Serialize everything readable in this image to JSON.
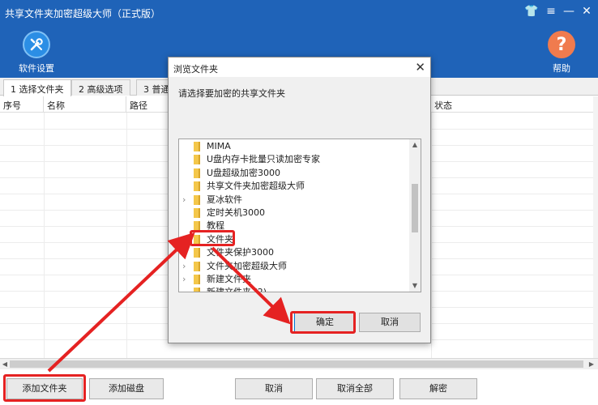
{
  "window": {
    "title": "共享文件夹加密超级大师（正式版）",
    "controls": {
      "skin": "👕",
      "menu": "≡",
      "minimize": "—",
      "close": "✕"
    }
  },
  "toolbar": {
    "settings_label": "软件设置",
    "help_label": "帮助",
    "help_glyph": "?"
  },
  "tabs": [
    {
      "label": "1 选择文件夹",
      "active": true
    },
    {
      "label": "2 高级选项",
      "active": false
    },
    {
      "label": "3 普通",
      "active": false
    }
  ],
  "table": {
    "columns": [
      "序号",
      "名称",
      "路径",
      "状态"
    ]
  },
  "buttons": {
    "add_folder": "添加文件夹",
    "add_disk": "添加磁盘",
    "cancel": "取消",
    "cancel_all": "取消全部",
    "decrypt": "解密"
  },
  "dialog": {
    "title": "浏览文件夹",
    "close_glyph": "✕",
    "prompt": "请选择要加密的共享文件夹",
    "folders": [
      {
        "label": "MIMA",
        "expandable": false
      },
      {
        "label": "U盘内存卡批量只读加密专家",
        "expandable": false
      },
      {
        "label": "U盘超级加密3000",
        "expandable": false
      },
      {
        "label": "共享文件夹加密超级大师",
        "expandable": false
      },
      {
        "label": "夏冰软件",
        "expandable": true
      },
      {
        "label": "定时关机3000",
        "expandable": false
      },
      {
        "label": "教程",
        "expandable": false
      },
      {
        "label": "文件夹",
        "expandable": true
      },
      {
        "label": "文件夹保护3000",
        "expandable": false
      },
      {
        "label": "文件夹加密超级大师",
        "expandable": true
      },
      {
        "label": "新建文件夹",
        "expandable": true
      },
      {
        "label": "新建文件夹 (2)",
        "expandable": false
      }
    ],
    "expander_glyph": "›",
    "scroll_up": "▲",
    "scroll_down": "▼",
    "ok_label": "确定",
    "cancel_label": "取消"
  },
  "scroll": {
    "left": "◀",
    "right": "▶"
  },
  "colors": {
    "accent": "#1f63b8",
    "highlight": "#e52222",
    "settings_icon": "#2b8ee5",
    "help_icon": "#f07b4e"
  }
}
